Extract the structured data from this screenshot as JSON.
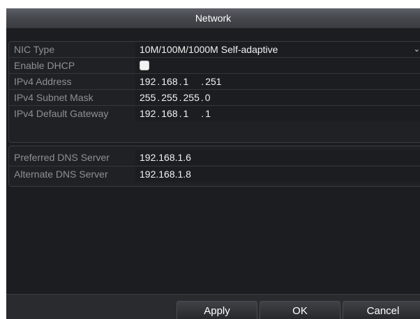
{
  "window": {
    "title": "Network"
  },
  "settings": {
    "nic_type_label": "NIC Type",
    "nic_type_value": "10M/100M/1000M Self-adaptive",
    "dhcp_label": "Enable DHCP",
    "dhcp_checked": false,
    "ipv4_address_label": "IPv4 Address",
    "ipv4_address": [
      "192",
      "168",
      "1",
      "251"
    ],
    "subnet_mask_label": "IPv4 Subnet Mask",
    "subnet_mask": [
      "255",
      "255",
      "255",
      "0"
    ],
    "gateway_label": "IPv4 Default Gateway",
    "gateway": [
      "192",
      "168",
      "1",
      "1"
    ]
  },
  "dns": {
    "preferred_label": "Preferred DNS Server",
    "preferred_value": "192.168.1.6",
    "alternate_label": "Alternate DNS Server",
    "alternate_value": "192.168.1.8"
  },
  "buttons": {
    "apply": "Apply",
    "ok": "OK",
    "cancel": "Cancel"
  },
  "icons": {
    "dropdown": "chevron-down-icon"
  },
  "colors": {
    "background": "#1b1d20",
    "label": "#8e9095",
    "value": "#f2f2f2"
  }
}
